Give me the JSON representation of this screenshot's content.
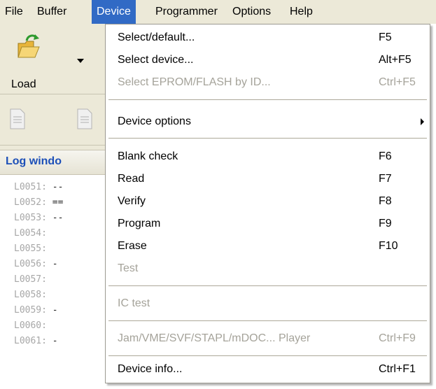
{
  "menubar": {
    "items": [
      {
        "label": "File"
      },
      {
        "label": "Buffer"
      },
      {
        "label": "Device"
      },
      {
        "label": "Programmer"
      },
      {
        "label": "Options"
      },
      {
        "label": "Help"
      }
    ],
    "active_color": "#316ac5"
  },
  "toolbar": {
    "load_label": "Load",
    "load_icon": "folder-open-icon",
    "dropdown_icon": "chevron-down-icon"
  },
  "log": {
    "title": "Log windo",
    "lines": [
      {
        "num": "L0051:",
        "text": " --"
      },
      {
        "num": "L0052:",
        "text": " =="
      },
      {
        "num": "L0053:",
        "text": " --"
      },
      {
        "num": "L0054:",
        "text": ""
      },
      {
        "num": "L0055:",
        "text": ""
      },
      {
        "num": "L0056:",
        "text": " -"
      },
      {
        "num": "L0057:",
        "text": ""
      },
      {
        "num": "L0058:",
        "text": ""
      },
      {
        "num": "L0059:",
        "text": " -"
      },
      {
        "num": "L0060:",
        "text": ""
      },
      {
        "num": "L0061:",
        "text": " -"
      }
    ]
  },
  "device_menu": {
    "items": [
      {
        "label": "Select/default...",
        "shortcut": "F5",
        "enabled": true
      },
      {
        "label": "Select device...",
        "shortcut": "Alt+F5",
        "enabled": true
      },
      {
        "label": "Select EPROM/FLASH by ID...",
        "shortcut": "Ctrl+F5",
        "enabled": false
      },
      {
        "label": "Device options",
        "shortcut": "",
        "enabled": true,
        "submenu": true
      },
      {
        "label": "Blank check",
        "shortcut": "F6",
        "enabled": true
      },
      {
        "label": "Read",
        "shortcut": "F7",
        "enabled": true
      },
      {
        "label": "Verify",
        "shortcut": "F8",
        "enabled": true
      },
      {
        "label": "Program",
        "shortcut": "F9",
        "enabled": true
      },
      {
        "label": "Erase",
        "shortcut": "F10",
        "enabled": true
      },
      {
        "label": "Test",
        "shortcut": "",
        "enabled": false
      },
      {
        "label": "IC test",
        "shortcut": "",
        "enabled": false
      },
      {
        "label": "Jam/VME/SVF/STAPL/mDOC... Player",
        "shortcut": "Ctrl+F9",
        "enabled": false
      },
      {
        "label": "Device info...",
        "shortcut": "Ctrl+F1",
        "enabled": true
      }
    ]
  }
}
